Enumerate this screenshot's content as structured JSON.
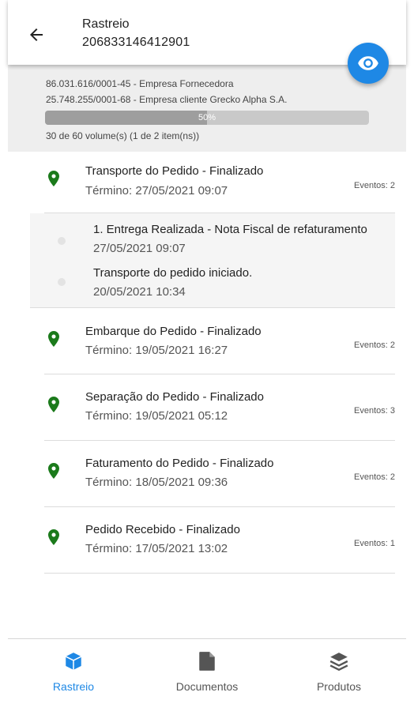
{
  "header": {
    "title": "Rastreio",
    "tracking_number": "206833146412901"
  },
  "summary": {
    "supplier": "86.031.616/0001-45 - Empresa Fornecedora",
    "client": "25.748.255/0001-68 - Empresa cliente Grecko Alpha S.A.",
    "progress_percent": 50,
    "progress_label": "50%",
    "volumes": "30 de 60 volume(s) (1 de 2 item(ns))"
  },
  "stages": [
    {
      "title": "Transporte do Pedido - Finalizado",
      "date": "Término: 27/05/2021 09:07",
      "events": "Eventos: 2"
    },
    {
      "title": "Embarque do Pedido - Finalizado",
      "date": "Término: 19/05/2021 16:27",
      "events": "Eventos: 2"
    },
    {
      "title": "Separação do Pedido - Finalizado",
      "date": "Término: 19/05/2021 05:12",
      "events": "Eventos: 3"
    },
    {
      "title": "Faturamento do Pedido - Finalizado",
      "date": "Término: 18/05/2021 09:36",
      "events": "Eventos: 2"
    },
    {
      "title": "Pedido Recebido - Finalizado",
      "date": "Término: 17/05/2021 13:02",
      "events": "Eventos: 1"
    }
  ],
  "expanded_events": [
    {
      "title": "1. Entrega Realizada - Nota Fiscal de refaturamento",
      "date": "27/05/2021 09:07"
    },
    {
      "title": "Transporte do pedido iniciado.",
      "date": "20/05/2021 10:34"
    }
  ],
  "nav": {
    "items": [
      {
        "label": "Rastreio",
        "icon": "cube-icon",
        "active": true
      },
      {
        "label": "Documentos",
        "icon": "document-icon",
        "active": false
      },
      {
        "label": "Produtos",
        "icon": "layers-icon",
        "active": false
      }
    ]
  },
  "colors": {
    "accent": "#1e88e5",
    "pin": "#1b7a1b",
    "summary_bg": "#eeeeee"
  }
}
